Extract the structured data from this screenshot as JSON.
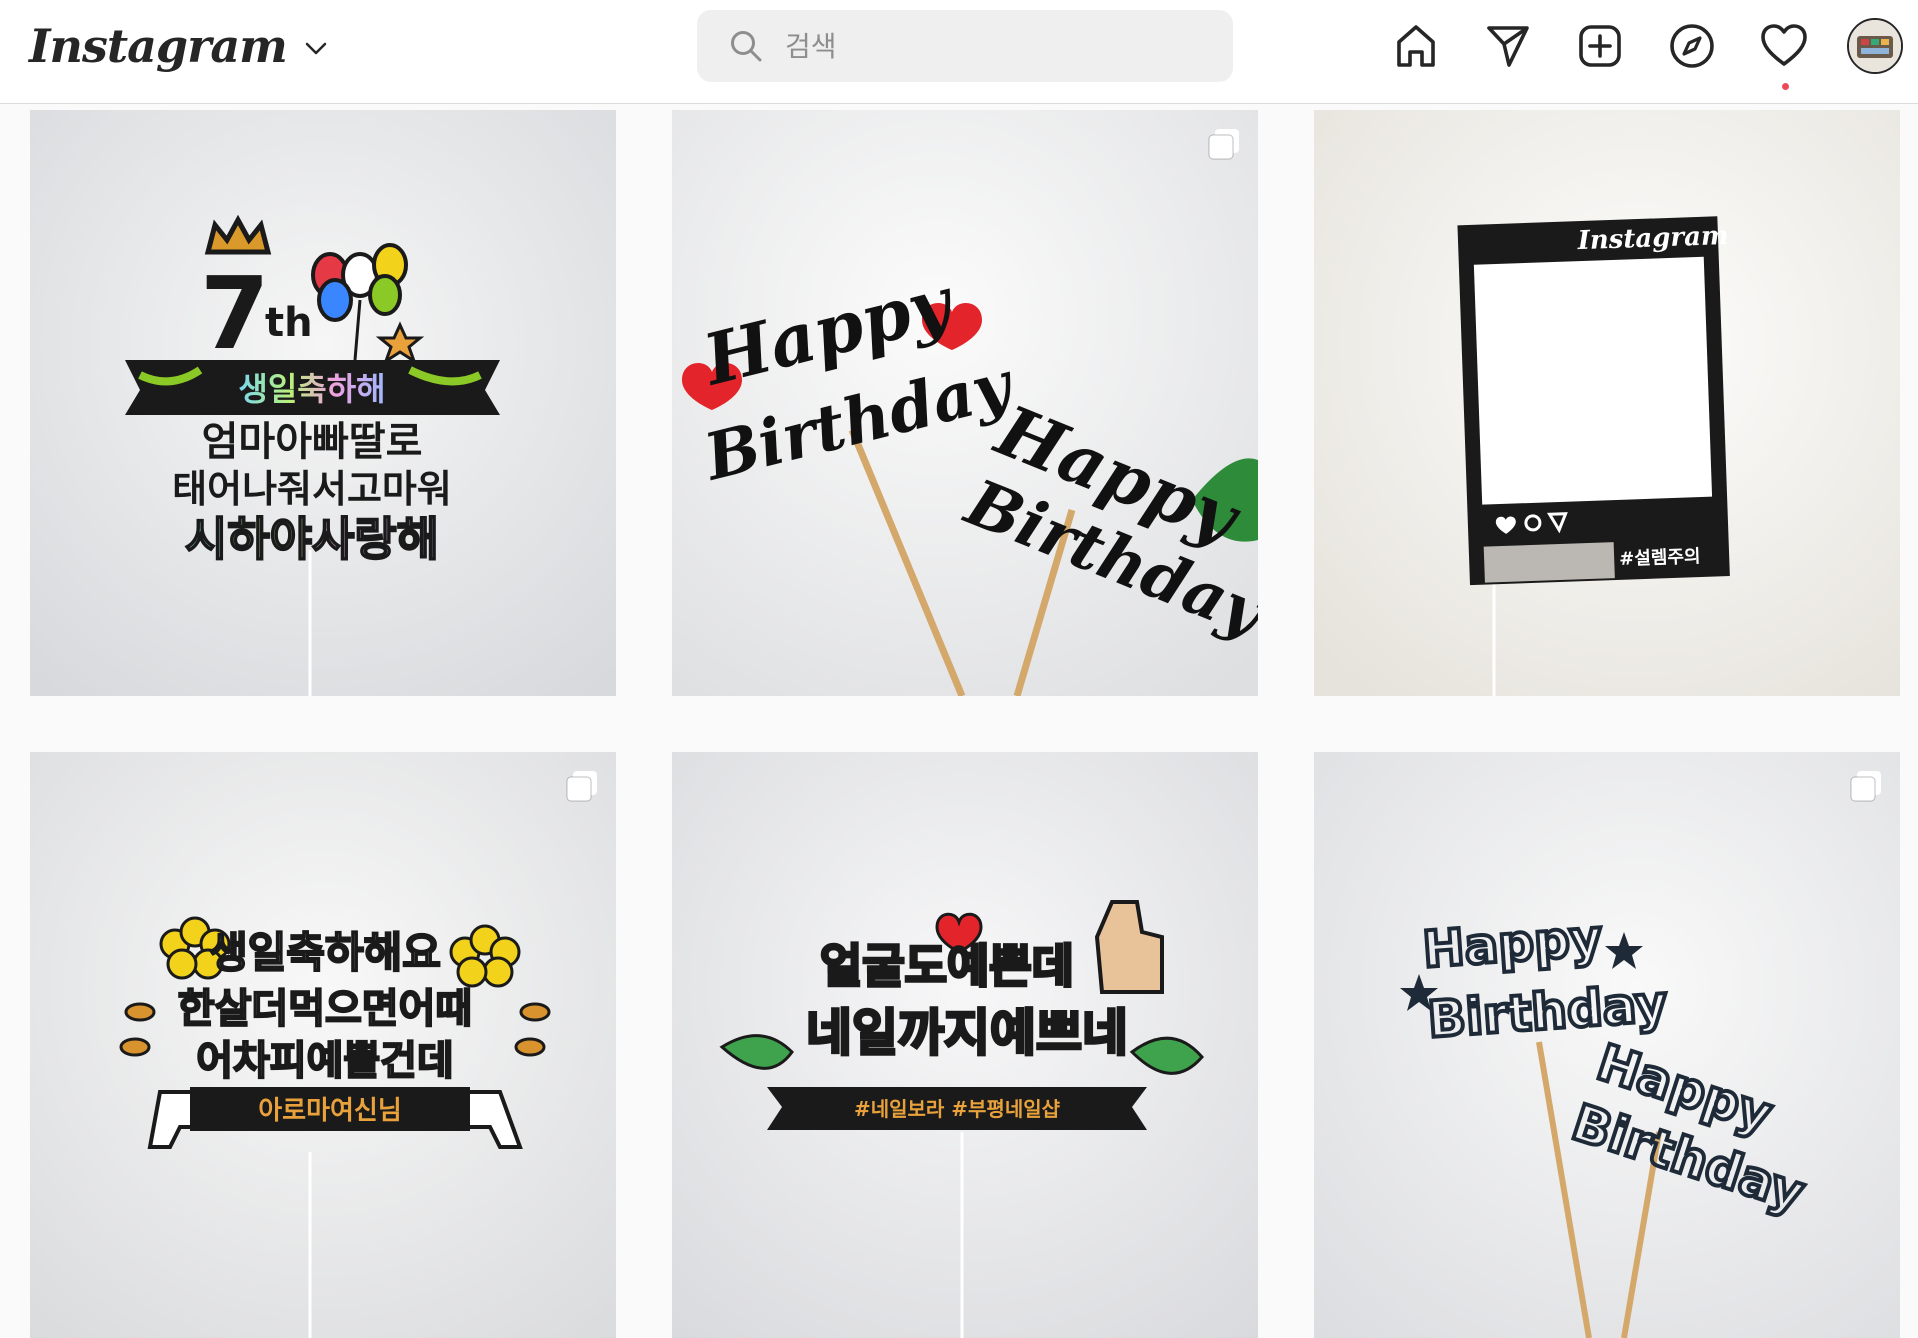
{
  "header": {
    "logo_text": "Instagram",
    "search": {
      "placeholder": "검색",
      "value": ""
    },
    "nav_icons": [
      "home-icon",
      "direct-icon",
      "new-post-icon",
      "explore-icon",
      "activity-heart-icon",
      "profile-avatar"
    ],
    "notification_dot_color": "#ed4956"
  },
  "posts": [
    {
      "id": "post-1",
      "multi": false,
      "topper": {
        "number": "7",
        "suffix": "th",
        "banner": "생일축하해",
        "lines": [
          "엄마아빠딸로",
          "태어나줘서고마워",
          "시하야사랑해"
        ]
      }
    },
    {
      "id": "post-2",
      "multi": true,
      "topper": {
        "lines": [
          "Happy",
          "Birthday",
          "Happy",
          "Birthday"
        ]
      }
    },
    {
      "id": "post-3",
      "multi": false,
      "topper": {
        "frame_logo": "Instagram",
        "caption": "#설렘주의"
      }
    },
    {
      "id": "post-4",
      "multi": true,
      "topper": {
        "lines": [
          "생일축하해요",
          "한살더먹으면어때",
          "어차피예쁠건데"
        ],
        "banner": "아로마여신님"
      }
    },
    {
      "id": "post-5",
      "multi": false,
      "topper": {
        "lines": [
          "얼굴도예쁜데",
          "네일까지예쁘네"
        ],
        "banner": "#네일보라 #부평네일샵"
      }
    },
    {
      "id": "post-6",
      "multi": true,
      "topper": {
        "lines": [
          "Happy",
          "Birthday",
          "Happy",
          "Birthday"
        ]
      }
    }
  ],
  "colors": {
    "header_bg": "#ffffff",
    "page_bg": "#fafafa",
    "search_bg": "#efefef",
    "icon": "#262626",
    "topper_black": "#1a1a1a",
    "wall_light": "#f2f2f2"
  }
}
